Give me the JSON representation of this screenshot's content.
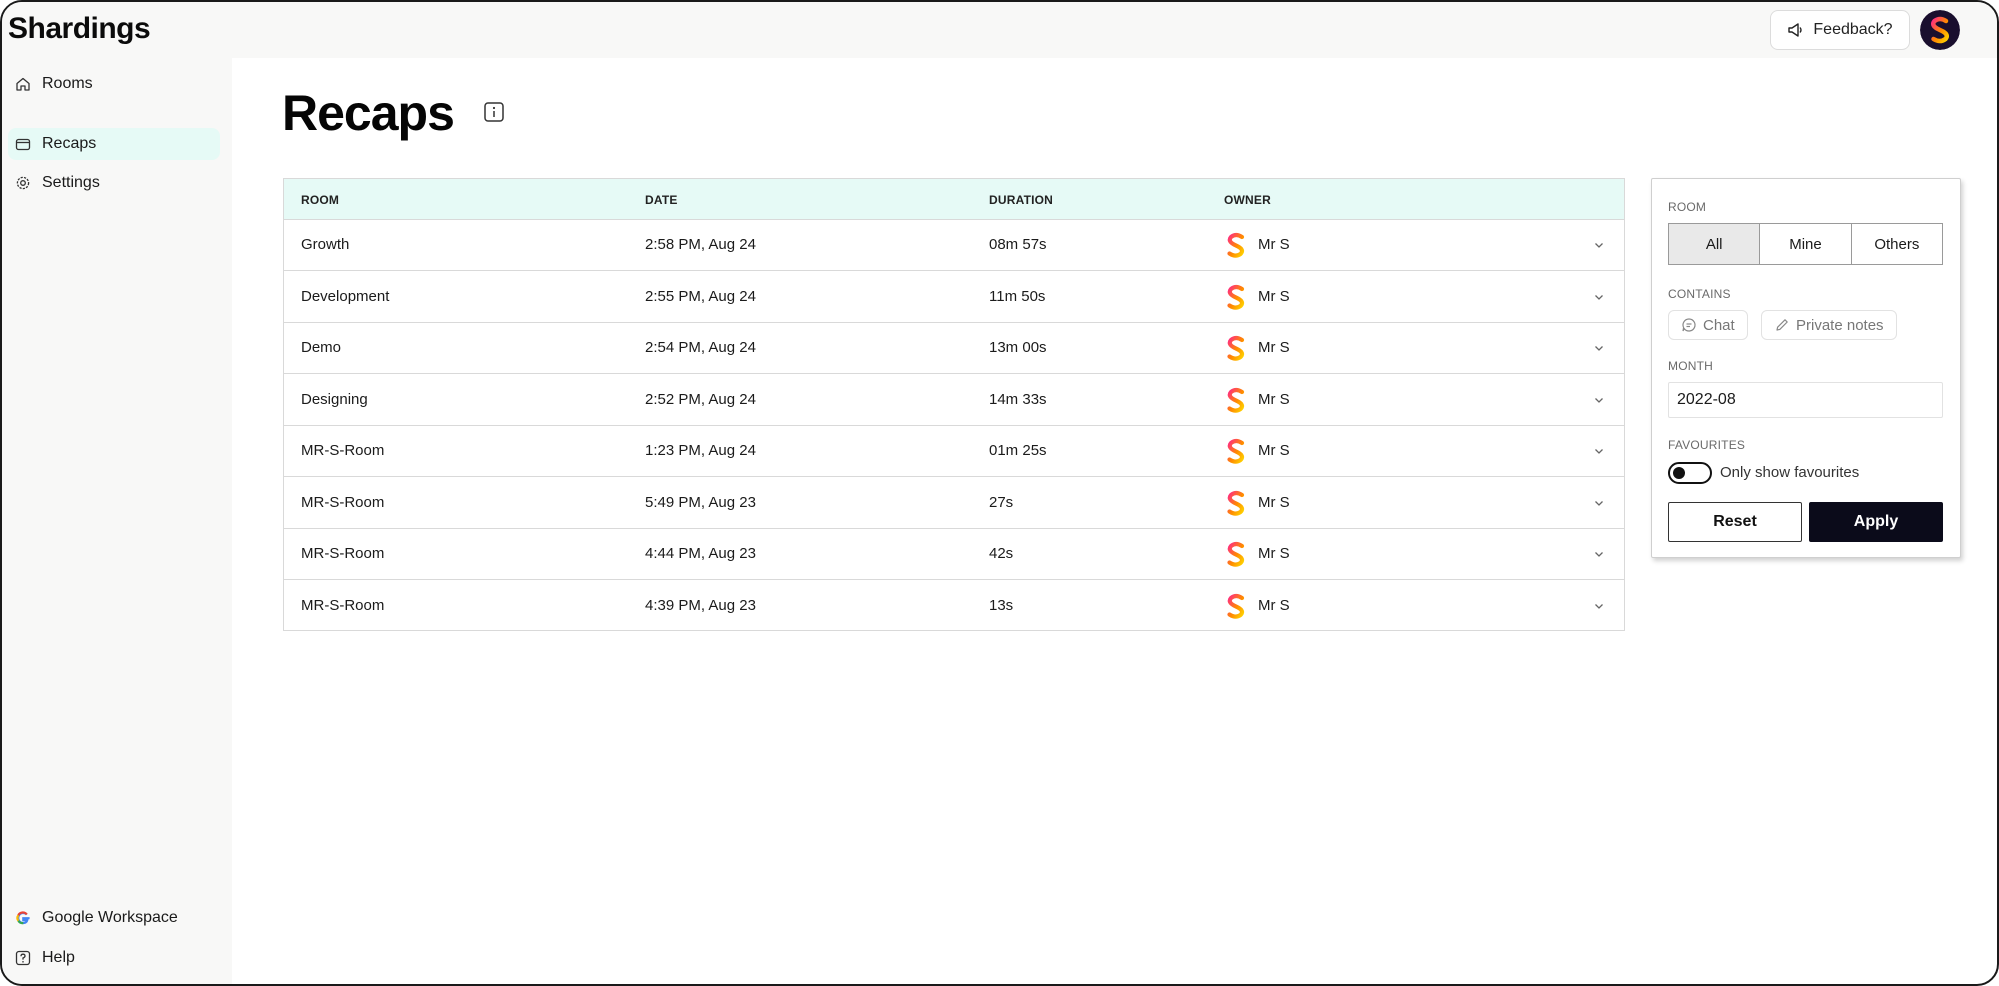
{
  "app": {
    "name": "Shardings"
  },
  "topbar": {
    "feedback_label": "Feedback?"
  },
  "sidebar": {
    "items": [
      {
        "label": "Rooms",
        "icon": "home-icon"
      },
      {
        "label": "Recaps",
        "icon": "folder-icon",
        "active": true
      },
      {
        "label": "Settings",
        "icon": "gear-icon"
      }
    ],
    "footer": [
      {
        "label": "Google Workspace",
        "icon": "google-icon"
      },
      {
        "label": "Help",
        "icon": "help-icon"
      }
    ]
  },
  "page": {
    "title": "Recaps"
  },
  "table": {
    "columns": [
      "ROOM",
      "DATE",
      "DURATION",
      "OWNER"
    ],
    "rows": [
      {
        "room": "Growth",
        "date": "2:58 PM, Aug 24",
        "duration": "08m 57s",
        "owner": "Mr S"
      },
      {
        "room": "Development",
        "date": "2:55 PM, Aug 24",
        "duration": "11m 50s",
        "owner": "Mr S"
      },
      {
        "room": "Demo",
        "date": "2:54 PM, Aug 24",
        "duration": "13m 00s",
        "owner": "Mr S"
      },
      {
        "room": "Designing",
        "date": "2:52 PM, Aug 24",
        "duration": "14m 33s",
        "owner": "Mr S"
      },
      {
        "room": "MR-S-Room",
        "date": "1:23 PM, Aug 24",
        "duration": "01m 25s",
        "owner": "Mr S"
      },
      {
        "room": "MR-S-Room",
        "date": "5:49 PM, Aug 23",
        "duration": "27s",
        "owner": "Mr S"
      },
      {
        "room": "MR-S-Room",
        "date": "4:44 PM, Aug 23",
        "duration": "42s",
        "owner": "Mr S"
      },
      {
        "room": "MR-S-Room",
        "date": "4:39 PM, Aug 23",
        "duration": "13s",
        "owner": "Mr S"
      }
    ]
  },
  "filters": {
    "room_label": "ROOM",
    "room_options": [
      "All",
      "Mine",
      "Others"
    ],
    "room_selected": "All",
    "contains_label": "CONTAINS",
    "contains_options": [
      "Chat",
      "Private notes"
    ],
    "month_label": "MONTH",
    "month_value": "2022-08",
    "favourites_label": "FAVOURITES",
    "favourites_toggle_label": "Only show favourites",
    "favourites_on": false,
    "reset_label": "Reset",
    "apply_label": "Apply"
  },
  "colors": {
    "accent_mint": "#e6faf6",
    "apply_dark": "#0b0b1a",
    "logo_gradient": [
      "#ff2e7e",
      "#ff8a00",
      "#ffd000"
    ]
  }
}
